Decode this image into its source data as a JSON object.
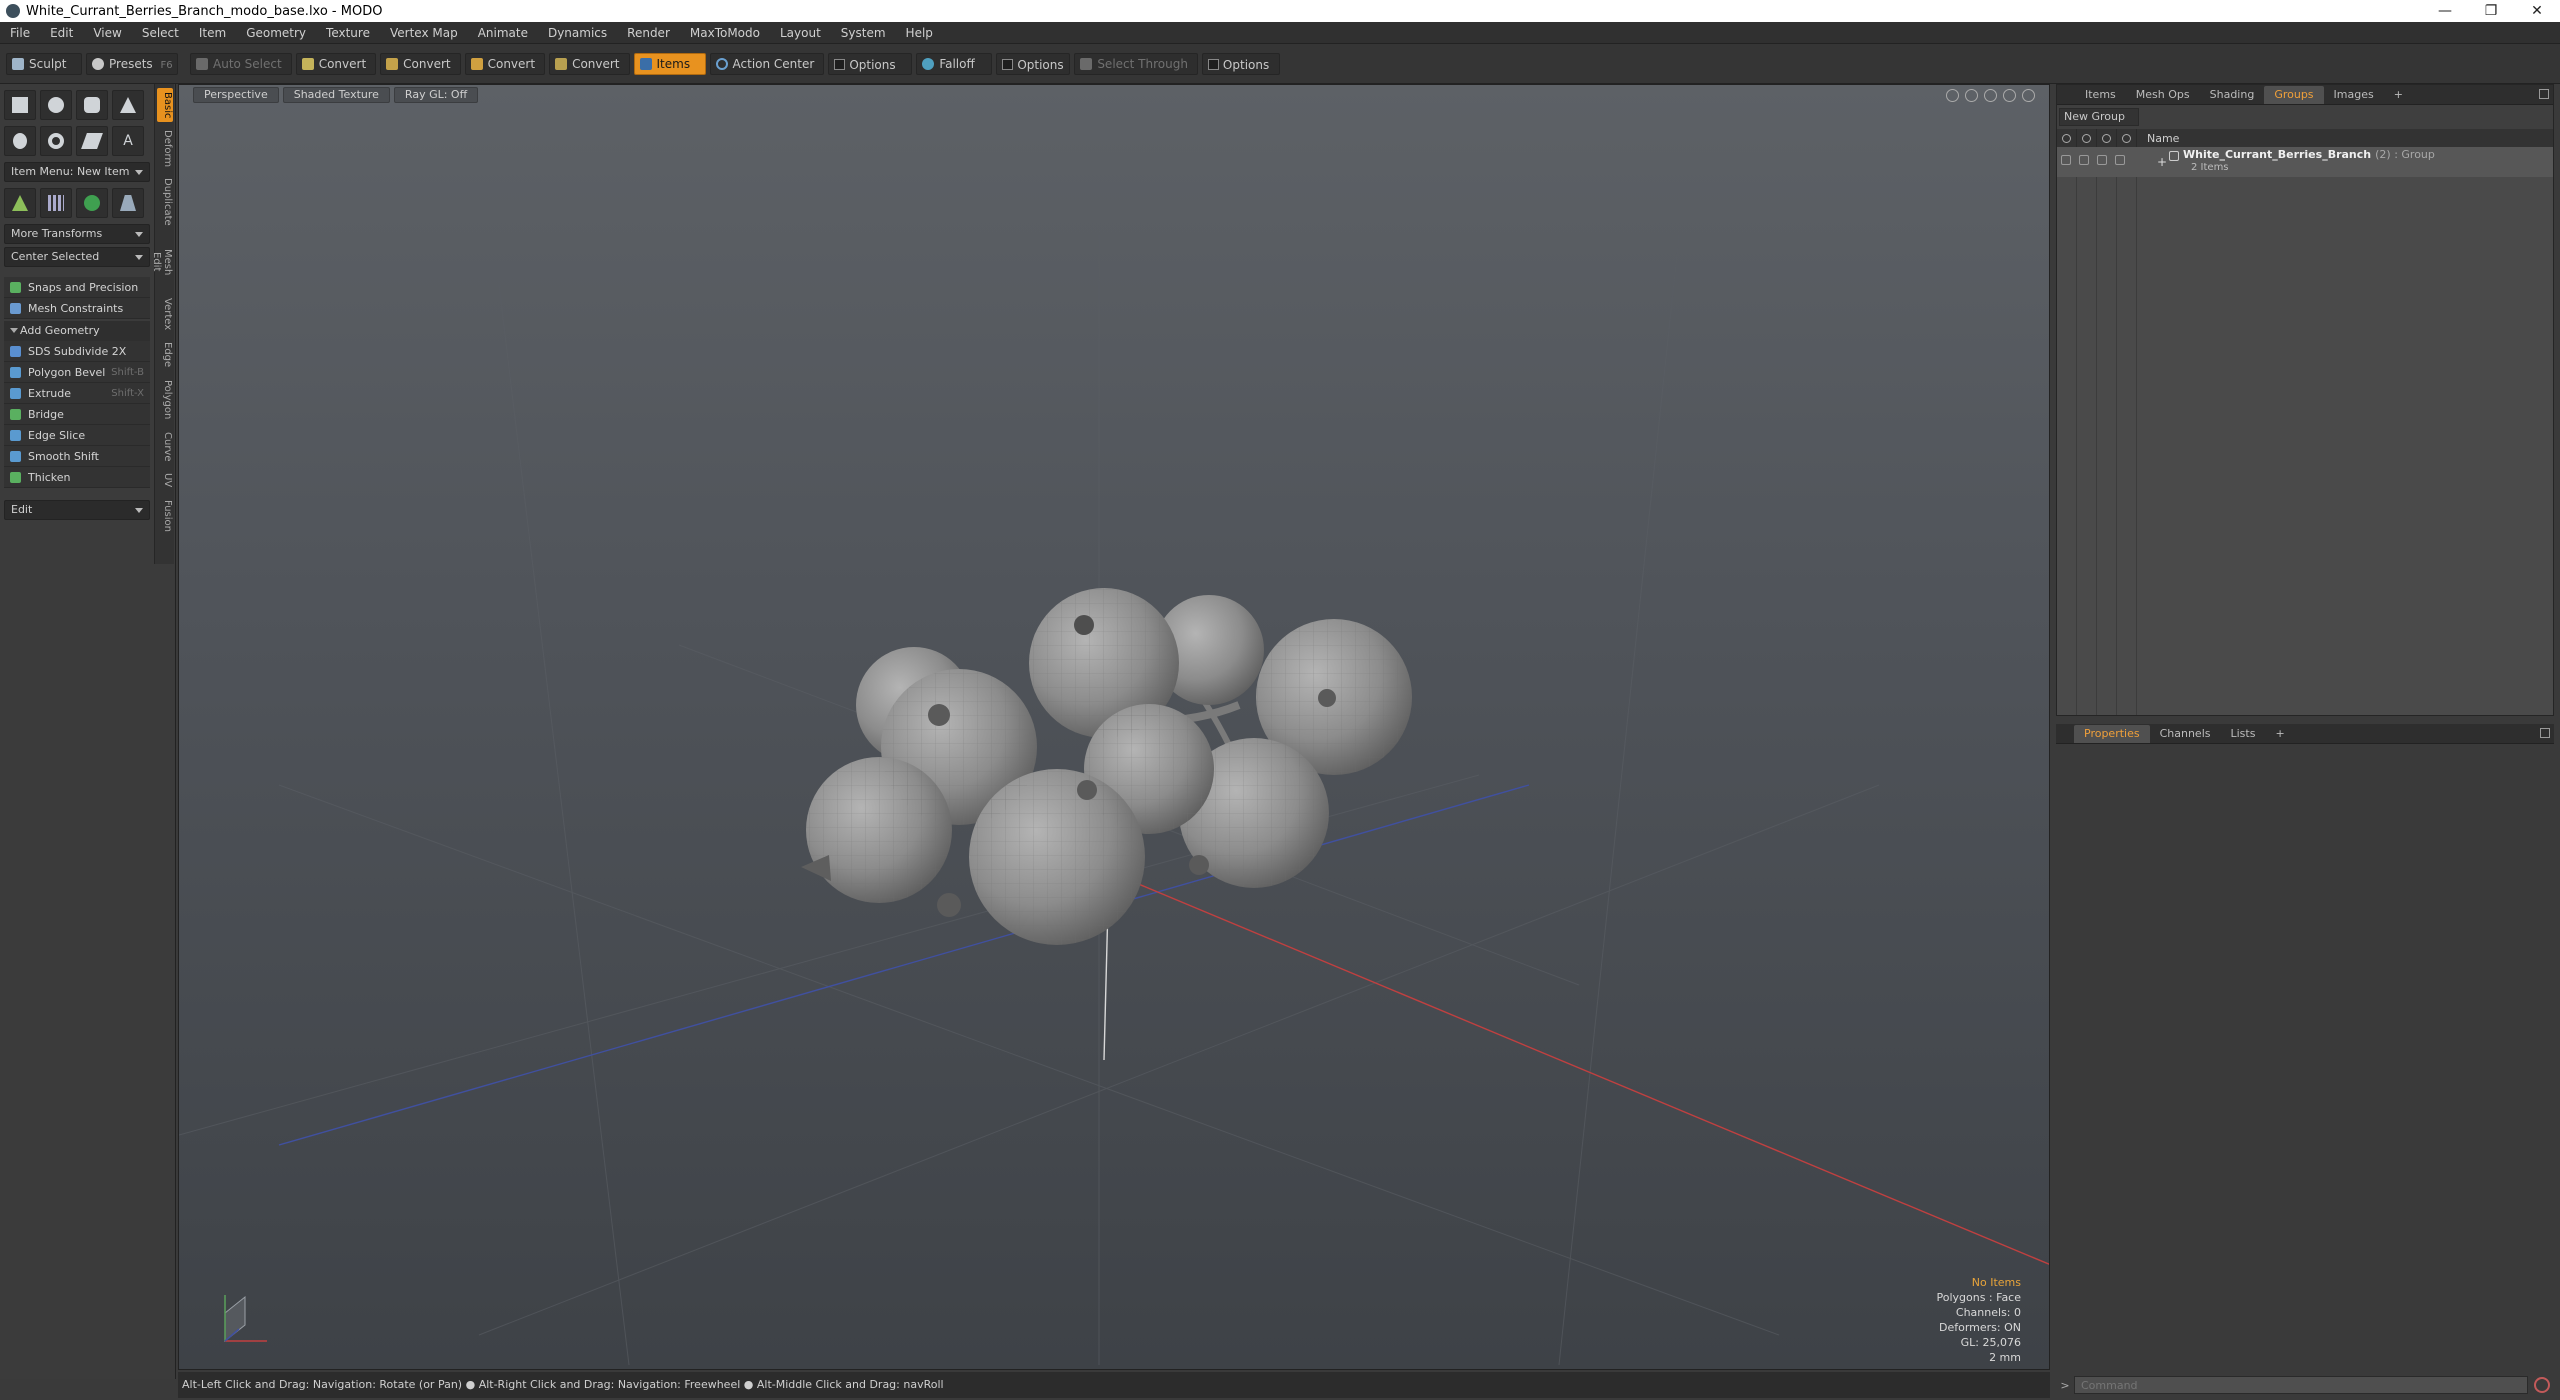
{
  "window": {
    "title": "White_Currant_Berries_Branch_modo_base.lxo - MODO",
    "controls": [
      "—",
      "❐",
      "✕"
    ]
  },
  "menu": [
    "File",
    "Edit",
    "View",
    "Select",
    "Item",
    "Geometry",
    "Texture",
    "Vertex Map",
    "Animate",
    "Dynamics",
    "Render",
    "MaxToModo",
    "Layout",
    "System",
    "Help"
  ],
  "toolbar": {
    "sculpt": "Sculpt",
    "presets": "Presets",
    "presets_shortcut": "F6",
    "auto_select": "Auto Select",
    "convert1": "Convert",
    "convert2": "Convert",
    "convert3": "Convert",
    "convert4": "Convert",
    "items": "Items",
    "action_center": "Action Center",
    "options1": "Options",
    "falloff": "Falloff",
    "options2": "Options",
    "select_through": "Select Through",
    "options3": "Options"
  },
  "left_panel": {
    "item_menu": "Item Menu: New Item",
    "more_transforms": "More Transforms",
    "center_selected": "Center Selected",
    "snaps": "Snaps and Precision",
    "mesh_constraints": "Mesh Constraints",
    "add_geometry": "Add Geometry",
    "tools": [
      {
        "label": "SDS Subdivide 2X",
        "shortcut": ""
      },
      {
        "label": "Polygon Bevel",
        "shortcut": "Shift-B"
      },
      {
        "label": "Extrude",
        "shortcut": "Shift-X"
      },
      {
        "label": "Bridge",
        "shortcut": ""
      },
      {
        "label": "Edge Slice",
        "shortcut": ""
      },
      {
        "label": "Smooth Shift",
        "shortcut": ""
      },
      {
        "label": "Thicken",
        "shortcut": ""
      }
    ],
    "edit": "Edit",
    "vtabs": [
      "Basic",
      "Deform",
      "Duplicate",
      "Mesh Edit",
      "Vertex",
      "Edge",
      "Polygon",
      "Curve",
      "UV",
      "Fusion"
    ]
  },
  "viewport": {
    "tabs": [
      "Perspective",
      "Shaded Texture",
      "Ray GL: Off"
    ],
    "info": {
      "no_items": "No Items",
      "polygons": "Polygons : Face",
      "channels": "Channels: 0",
      "deformers": "Deformers: ON",
      "gl": "GL: 25,076",
      "scale": "2 mm"
    }
  },
  "status_bar": "Alt-Left Click and Drag: Navigation: Rotate (or Pan) ● Alt-Right Click and Drag: Navigation: Freewheel ● Alt-Middle Click and Drag: navRoll",
  "right_panel": {
    "top_tabs": [
      "Items",
      "Mesh Ops",
      "Shading",
      "Groups",
      "Images",
      "+"
    ],
    "new_group": "New Group",
    "name_header": "Name",
    "group": {
      "name": "White_Currant_Berries_Branch",
      "type": "(2) : Group",
      "count": "2 Items"
    },
    "bottom_tabs": [
      "Properties",
      "Channels",
      "Lists",
      "+"
    ],
    "command_placeholder": "Command"
  },
  "colors": {
    "accent": "#e8921f",
    "axis_x": "#c04040",
    "axis_z": "#4050a0"
  }
}
